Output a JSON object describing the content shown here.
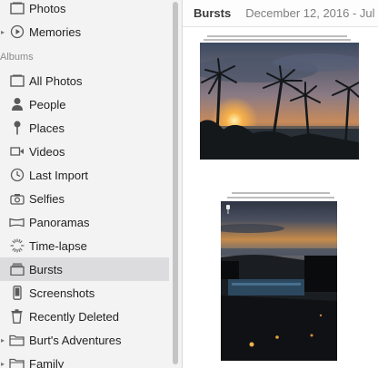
{
  "sidebar": {
    "top_items": [
      {
        "label": "Photos",
        "icon": "photos-icon"
      },
      {
        "label": "Memories",
        "icon": "memories-icon"
      }
    ],
    "albums_header": "Albums",
    "albums": [
      {
        "label": "All Photos",
        "icon": "all-photos-icon"
      },
      {
        "label": "People",
        "icon": "person-icon"
      },
      {
        "label": "Places",
        "icon": "pin-icon"
      },
      {
        "label": "Videos",
        "icon": "video-icon"
      },
      {
        "label": "Last Import",
        "icon": "clock-icon"
      },
      {
        "label": "Selfies",
        "icon": "camera-icon"
      },
      {
        "label": "Panoramas",
        "icon": "panorama-icon"
      },
      {
        "label": "Time-lapse",
        "icon": "timelapse-icon"
      },
      {
        "label": "Bursts",
        "icon": "bursts-icon",
        "selected": true
      },
      {
        "label": "Screenshots",
        "icon": "phone-icon"
      },
      {
        "label": "Recently Deleted",
        "icon": "trash-icon"
      },
      {
        "label": "Burt's Adventures",
        "icon": "folder-icon"
      },
      {
        "label": "Family",
        "icon": "folder-icon"
      }
    ]
  },
  "main": {
    "title": "Bursts",
    "date_range": "December 12, 2016 - Jul",
    "photos": [
      {
        "description": "sunset-palms-burst",
        "orientation": "landscape"
      },
      {
        "description": "resort-dusk-burst",
        "orientation": "portrait"
      }
    ]
  },
  "colors": {
    "sidebar_bg": "#f3f3f3",
    "selected_bg": "#dcdcde",
    "icon_gray": "#5a5a5a"
  }
}
